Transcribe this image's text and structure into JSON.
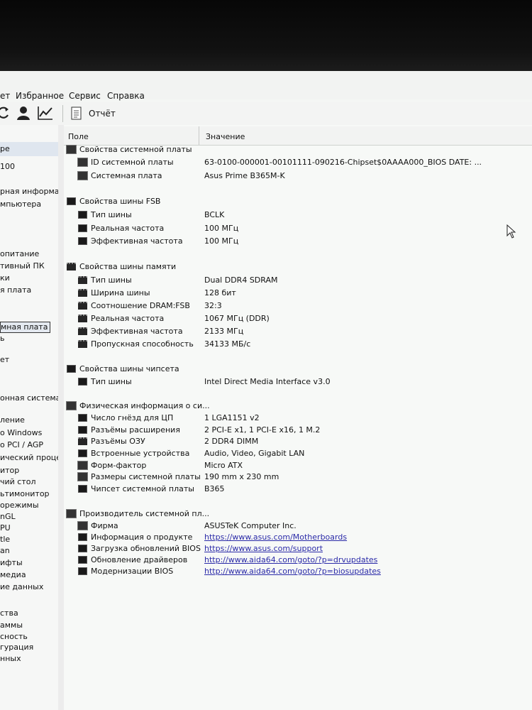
{
  "menu": [
    "ет",
    "Избранное",
    "Сервис",
    "Справка"
  ],
  "toolbar": {
    "icons": [
      "refresh-icon",
      "user-icon",
      "chart-icon",
      "report-icon"
    ],
    "report_label": "Отчёт"
  },
  "sidebar": {
    "items": [
      "ре",
      "100",
      "рная информа",
      "мпьютера",
      "опитание",
      "тивный ПК",
      "ки",
      "я плата",
      "мная плата",
      "ь",
      "ет",
      "онная система",
      "ление",
      "о Windows",
      "о PCI / AGP",
      "ический процесс",
      "итор",
      "чий стол",
      "ьтимонитор",
      "орежимы",
      "nGL",
      "PU",
      "tle",
      "an",
      "ифты",
      "медиа",
      "ие данных",
      "ства",
      "аммы",
      "сность",
      "гурация",
      "нных"
    ]
  },
  "table": {
    "col_field": "Поле",
    "col_value": "Значение",
    "rows": [
      {
        "label": "Свойства системной платы",
        "value": "",
        "group": true,
        "icon": "motherboard-icon"
      },
      {
        "label": "ID системной платы",
        "value": "63-0100-000001-00101111-090216-Chipset$0AAAA000_BIOS DATE: ...",
        "icon": "motherboard-icon"
      },
      {
        "label": "Системная плата",
        "value": "Asus Prime B365M-K",
        "icon": "motherboard-icon"
      },
      {
        "label": "Свойства шины FSB",
        "value": "",
        "group": true,
        "icon": "bus-icon"
      },
      {
        "label": "Тип шины",
        "value": "BCLK",
        "icon": "bus-icon"
      },
      {
        "label": "Реальная частота",
        "value": "100 МГц",
        "icon": "bus-icon"
      },
      {
        "label": "Эффективная частота",
        "value": "100 МГц",
        "icon": "bus-icon"
      },
      {
        "label": "Свойства шины памяти",
        "value": "",
        "group": true,
        "icon": "memory-icon"
      },
      {
        "label": "Тип шины",
        "value": "Dual DDR4 SDRAM",
        "icon": "memory-icon"
      },
      {
        "label": "Ширина шины",
        "value": "128 бит",
        "icon": "memory-icon"
      },
      {
        "label": "Соотношение DRAM:FSB",
        "value": "32:3",
        "icon": "memory-icon"
      },
      {
        "label": "Реальная частота",
        "value": "1067 МГц (DDR)",
        "icon": "memory-icon"
      },
      {
        "label": "Эффективная частота",
        "value": "2133 МГц",
        "icon": "memory-icon"
      },
      {
        "label": "Пропускная способность",
        "value": "34133 МБ/с",
        "icon": "memory-icon"
      },
      {
        "label": "Свойства шины чипсета",
        "value": "",
        "group": true,
        "icon": "chipset-icon"
      },
      {
        "label": "Тип шины",
        "value": "Intel Direct Media Interface v3.0",
        "icon": "chipset-icon"
      },
      {
        "label": "Физическая информация о си...",
        "value": "",
        "group": true,
        "icon": "motherboard-icon"
      },
      {
        "label": "Число гнёзд для ЦП",
        "value": "1 LGA1151 v2",
        "icon": "socket-icon"
      },
      {
        "label": "Разъёмы расширения",
        "value": "2 PCI-E x1, 1 PCI-E x16, 1 M.2",
        "icon": "slot-icon"
      },
      {
        "label": "Разъёмы ОЗУ",
        "value": "2 DDR4 DIMM",
        "icon": "memory-icon"
      },
      {
        "label": "Встроенные устройства",
        "value": "Audio, Video, Gigabit LAN",
        "icon": "device-icon"
      },
      {
        "label": "Форм-фактор",
        "value": "Micro ATX",
        "icon": "motherboard-icon"
      },
      {
        "label": "Размеры системной платы",
        "value": "190 mm x 230 mm",
        "icon": "motherboard-icon"
      },
      {
        "label": "Чипсет системной платы",
        "value": "B365",
        "icon": "chipset-icon"
      },
      {
        "label": "Производитель системной пл...",
        "value": "",
        "group": true,
        "icon": "motherboard-icon"
      },
      {
        "label": "Фирма",
        "value": "ASUSTeK Computer Inc.",
        "icon": "motherboard-icon"
      },
      {
        "label": "Информация о продукте",
        "value": "https://www.asus.com/Motherboards",
        "icon": "info-icon",
        "link": true
      },
      {
        "label": "Загрузка обновлений BIOS",
        "value": "https://www.asus.com/support",
        "icon": "download-icon",
        "link": true
      },
      {
        "label": "Обновление драйверов",
        "value": "http://www.aida64.com/goto/?p=drvupdates",
        "icon": "driver-update-icon",
        "link": true
      },
      {
        "label": "Модернизации BIOS",
        "value": "http://www.aida64.com/goto/?p=biosupdates",
        "icon": "bios-upgrade-icon",
        "link": true
      }
    ]
  }
}
